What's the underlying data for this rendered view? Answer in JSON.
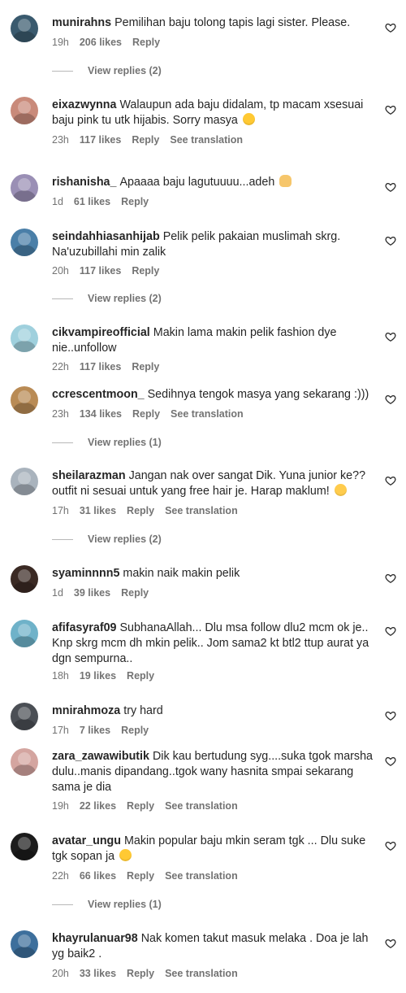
{
  "comments": [
    {
      "user": "munirahns",
      "text": "Pemilihan baju tolong tapis lagi sister. Please.",
      "time": "19h",
      "likes": "206 likes",
      "reply": "Reply",
      "translate": "",
      "replies": "View replies (2)",
      "avatar_color": "#3a5a6e"
    },
    {
      "user": "eixazwynna",
      "text": "Walaupun ada baju didalam, tp macam xsesuai baju pink tu utk hijabis. Sorry masya",
      "emoji": "pensive",
      "time": "23h",
      "likes": "117 likes",
      "reply": "Reply",
      "translate": "See translation",
      "replies": "",
      "avatar_color": "#c98a7a"
    },
    {
      "user": "rishanisha_",
      "text": "Apaaaa baju lagutuuuu...adeh",
      "emoji": "person",
      "time": "1d",
      "likes": "61 likes",
      "reply": "Reply",
      "translate": "",
      "replies": "",
      "avatar_color": "#9a8fb5"
    },
    {
      "user": "seindahhiasanhijab",
      "text": "Pelik pelik pakaian muslimah skrg. Na'uzubillahi min zalik",
      "time": "20h",
      "likes": "117 likes",
      "reply": "Reply",
      "translate": "",
      "replies": "View replies (2)",
      "avatar_color": "#4a7fa8"
    },
    {
      "user": "cikvampireofficial",
      "text": "Makin lama makin pelik fashion dye nie..unfollow",
      "time": "22h",
      "likes": "117 likes",
      "reply": "Reply",
      "translate": "",
      "replies": "",
      "avatar_color": "#9fd0dd"
    },
    {
      "user": "ccrescentmoon_",
      "text": "Sedihnya tengok masya yang sekarang :)))",
      "time": "23h",
      "likes": "134 likes",
      "reply": "Reply",
      "translate": "See translation",
      "replies": "View replies (1)",
      "avatar_color": "#b98b55"
    },
    {
      "user": "sheilarazman",
      "text": "Jangan nak over sangat Dik. Yuna junior ke?? outfit ni sesuai untuk yang free hair je. Harap maklum!",
      "emoji": "disappointed",
      "time": "17h",
      "likes": "31 likes",
      "reply": "Reply",
      "translate": "See translation",
      "replies": "View replies (2)",
      "avatar_color": "#a9b3bd"
    },
    {
      "user": "syaminnnn5",
      "text": "makin naik makin pelik",
      "time": "1d",
      "likes": "39 likes",
      "reply": "Reply",
      "translate": "",
      "replies": "",
      "avatar_color": "#3b2a24"
    },
    {
      "user": "afifasyraf09",
      "text": "SubhanaAllah... Dlu msa follow dlu2 mcm ok je.. Knp skrg mcm dh mkin pelik.. Jom sama2 kt btl2 ttup aurat ya dgn sempurna..",
      "time": "18h",
      "likes": "19 likes",
      "reply": "Reply",
      "translate": "",
      "replies": "",
      "avatar_color": "#6fb2c9"
    },
    {
      "user": "mnirahmoza",
      "text": "try hard",
      "time": "17h",
      "likes": "7 likes",
      "reply": "Reply",
      "translate": "",
      "replies": "",
      "avatar_color": "#4b4f55"
    },
    {
      "user": "zara_zawawibutik",
      "text": "Dik kau bertudung syg....suka tgok marsha dulu..manis dipandang..tgok wany hasnita smpai sekarang sama je dia",
      "time": "19h",
      "likes": "22 likes",
      "reply": "Reply",
      "translate": "See translation",
      "replies": "",
      "avatar_color": "#d4a5a0"
    },
    {
      "user": "avatar_ungu",
      "text": "Makin popular baju mkin seram tgk ... Dlu suke tgk sopan ja",
      "emoji": "pensive",
      "time": "22h",
      "likes": "66 likes",
      "reply": "Reply",
      "translate": "See translation",
      "replies": "View replies (1)",
      "avatar_color": "#1c1c1c"
    },
    {
      "user": "khayrulanuar98",
      "text": "Nak komen takut masuk melaka . Doa je lah yg baik2 .",
      "time": "20h",
      "likes": "33 likes",
      "reply": "Reply",
      "translate": "See translation",
      "replies": "",
      "avatar_color": "#3d6f9c"
    }
  ],
  "icons": {
    "like": "heart-outline-icon"
  },
  "colors": {
    "text": "#262626",
    "meta": "#737373"
  }
}
